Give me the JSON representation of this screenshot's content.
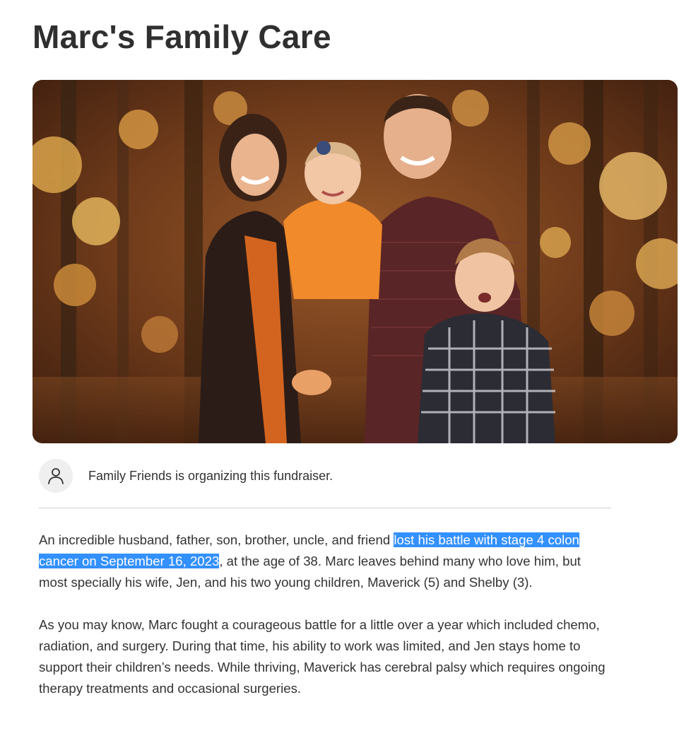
{
  "page": {
    "title": "Marc's Family Care"
  },
  "hero": {
    "alt": "Family photo in autumn woods"
  },
  "organizer": {
    "icon": "user-icon",
    "text": "Family Friends is organizing this fundraiser."
  },
  "story": {
    "p1_before": "An incredible husband, father, son, brother, uncle, and friend ",
    "p1_highlight": "lost his battle with stage 4 colon cancer on September 16, 2023",
    "p1_after": ", at the age of 38. Marc leaves behind many who love him, but most specially his wife, Jen, and his two young children, Maverick (5) and Shelby (3).",
    "p2": "As you may know, Marc fought a courageous battle for a little over a year which included chemo, radiation, and surgery. During that time, his ability to work was limited, and Jen stays home to support their children’s needs. While thriving, Maverick has cerebral palsy which requires ongoing therapy treatments and occasional surgeries."
  },
  "colors": {
    "highlight": "#3390ff",
    "text": "#333333",
    "avatar_bg": "#efefef"
  }
}
